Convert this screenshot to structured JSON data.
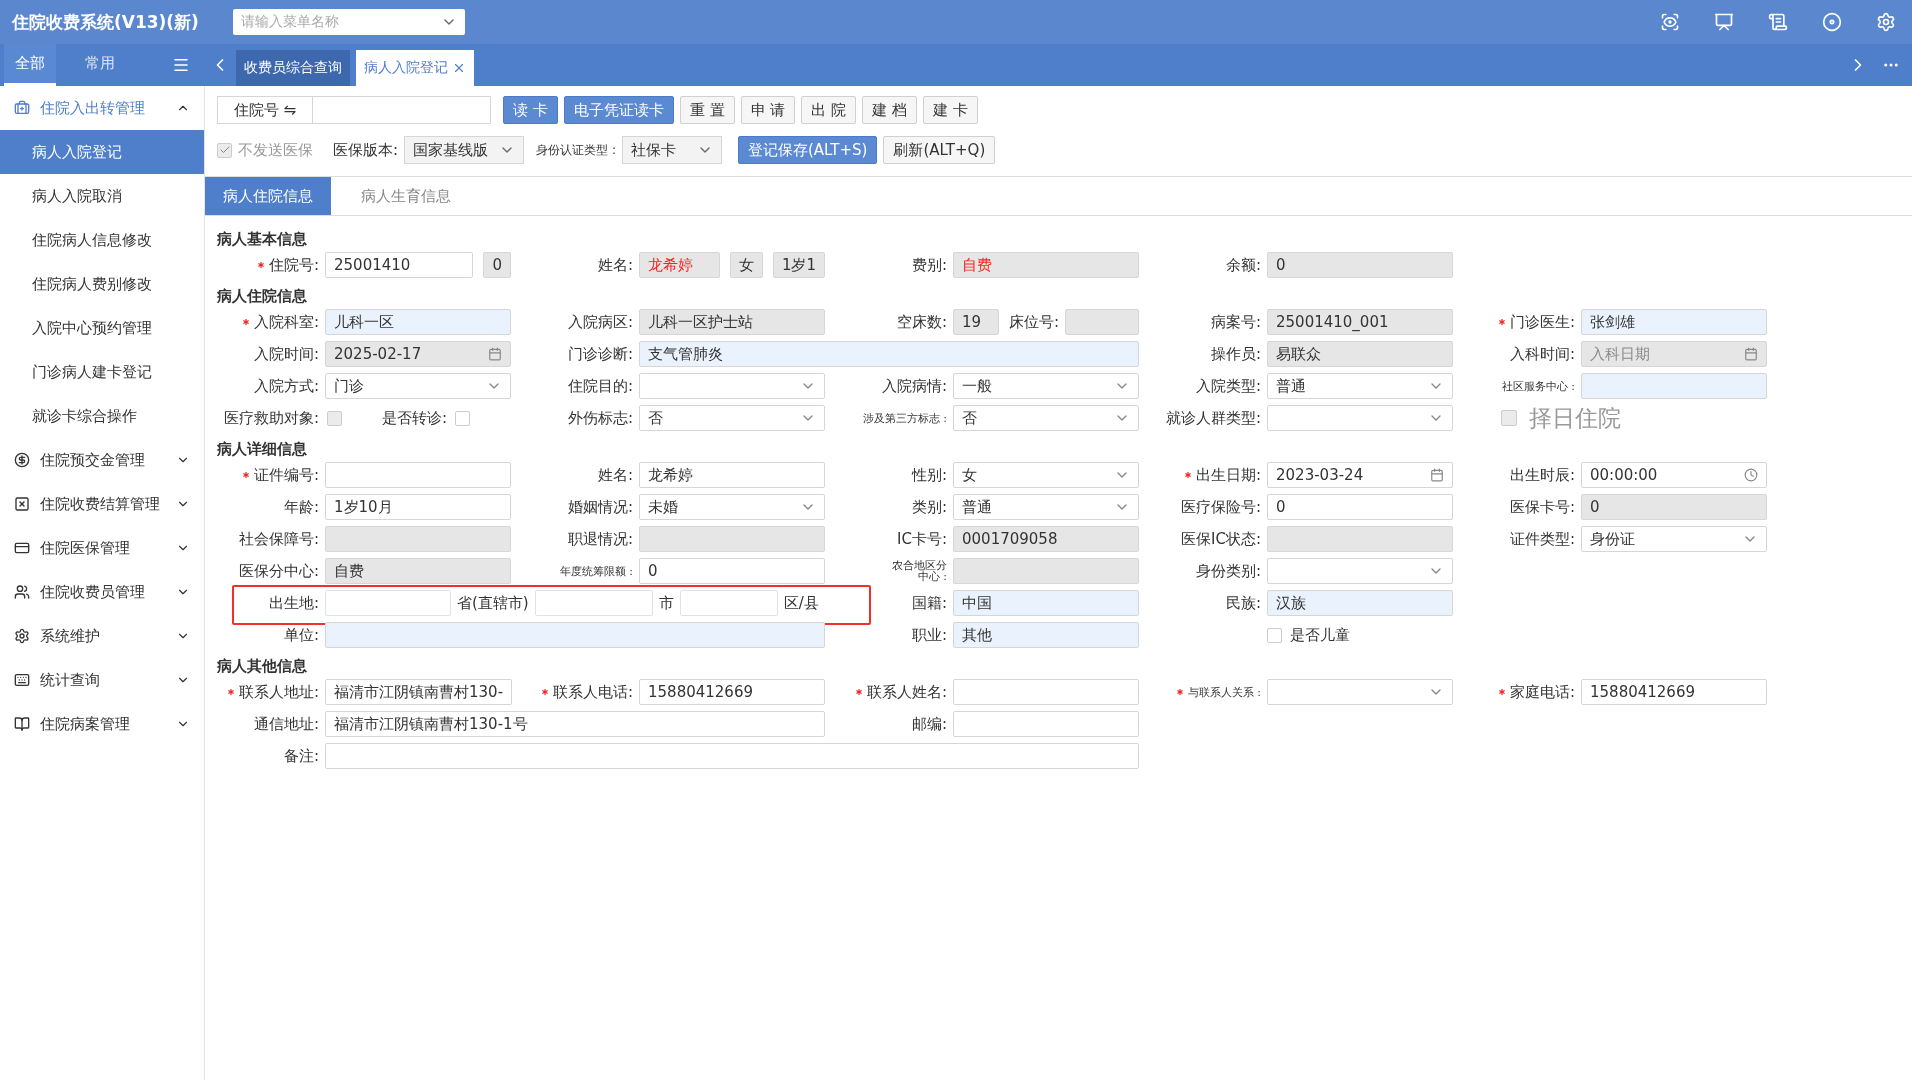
{
  "app_title": "住院收费系统(V13)(新)",
  "menu_search": {
    "placeholder": "请输入菜单名称"
  },
  "nav_tabs": [
    {
      "label": "全部",
      "selected": true
    },
    {
      "label": "常用",
      "selected": false
    }
  ],
  "page_tabs": [
    {
      "label": "收费员综合查询",
      "selected": false,
      "closable": false
    },
    {
      "label": "病人入院登记",
      "selected": true,
      "closable": true
    }
  ],
  "sidebar": [
    {
      "label": "住院入出转管理",
      "expanded": true,
      "children": [
        {
          "label": "病人入院登记",
          "selected": true
        },
        {
          "label": "病人入院取消",
          "selected": false
        },
        {
          "label": "住院病人信息修改",
          "selected": false
        },
        {
          "label": "住院病人费别修改",
          "selected": false
        },
        {
          "label": "入院中心预约管理",
          "selected": false
        },
        {
          "label": "门诊病人建卡登记",
          "selected": false
        },
        {
          "label": "就诊卡综合操作",
          "selected": false
        }
      ]
    },
    {
      "label": "住院预交金管理",
      "expanded": false
    },
    {
      "label": "住院收费结算管理",
      "expanded": false
    },
    {
      "label": "住院医保管理",
      "expanded": false
    },
    {
      "label": "住院收费员管理",
      "expanded": false
    },
    {
      "label": "系统维护",
      "expanded": false
    },
    {
      "label": "统计查询",
      "expanded": false
    },
    {
      "label": "住院病案管理",
      "expanded": false
    }
  ],
  "toolbar": {
    "id_type": "住院号 ⇋",
    "buttons": [
      {
        "label": "读 卡",
        "primary": true
      },
      {
        "label": "电子凭证读卡",
        "primary": true
      },
      {
        "label": "重 置",
        "primary": false
      },
      {
        "label": "申 请",
        "primary": false
      },
      {
        "label": "出 院",
        "primary": false
      },
      {
        "label": "建 档",
        "primary": false
      },
      {
        "label": "建 卡",
        "primary": false
      }
    ],
    "no_send": {
      "label": "不发送医保",
      "checked": true
    },
    "insurance_version": {
      "label": "医保版本:",
      "value": "国家基线版"
    },
    "auth_type": {
      "label": "身份认证类型 :",
      "value": "社保卡"
    },
    "actions": [
      {
        "label": "登记保存(ALT+S)",
        "primary": true
      },
      {
        "label": "刷新(ALT+Q)",
        "primary": false
      }
    ]
  },
  "sub_tabs": [
    {
      "label": "病人住院信息",
      "selected": true
    },
    {
      "label": "病人生育信息",
      "selected": false
    }
  ],
  "sections": [
    {
      "title": "病人基本信息",
      "rows": [
        [
          {
            "kind": "input",
            "label": "住院号:",
            "required": true,
            "value": "25001410",
            "readonly": false,
            "highlighted": false,
            "addons": [
              "0"
            ]
          },
          {
            "kind": "input",
            "label": "姓名:",
            "required": false,
            "value": "龙希婷",
            "readonly": true,
            "highlighted": false,
            "color": "#ff2020",
            "addons": [
              "女",
              "1岁1"
            ]
          },
          {
            "kind": "input",
            "label": "费别:",
            "required": false,
            "value": "自费",
            "readonly": true,
            "highlighted": false,
            "color": "#ff2020"
          },
          {
            "kind": "input",
            "label": "余额:",
            "required": false,
            "value": "0",
            "readonly": true,
            "highlighted": false
          }
        ]
      ]
    },
    {
      "title": "病人住院信息",
      "rows": [
        [
          {
            "kind": "input",
            "label": "入院科室:",
            "required": true,
            "value": "儿科一区",
            "readonly": false,
            "highlighted": true
          },
          {
            "kind": "input",
            "label": "入院病区:",
            "required": false,
            "value": "儿科一区护士站",
            "readonly": true,
            "highlighted": false
          },
          {
            "kind": "pair",
            "label": "空床数:",
            "required": false,
            "value": "19",
            "readonly": true,
            "highlighted": false,
            "sub_label": "床位号:",
            "sub_readonly": true
          },
          {
            "kind": "input",
            "label": "病案号:",
            "required": false,
            "value": "25001410_001",
            "readonly": true,
            "highlighted": false
          },
          {
            "kind": "input",
            "label": "门诊医生:",
            "required": true,
            "value": "张剑雄",
            "readonly": false,
            "highlighted": true
          }
        ],
        [
          {
            "kind": "date",
            "label": "入院时间:",
            "required": false,
            "value": "2025-02-17",
            "readonly": true,
            "highlighted": false
          },
          {
            "kind": "input",
            "label": "门诊诊断:",
            "required": false,
            "value": "支气管肺炎",
            "readonly": false,
            "highlighted": true
          },
          "",
          {
            "kind": "input",
            "label": "操作员:",
            "required": false,
            "value": "易联众",
            "readonly": true,
            "highlighted": false
          },
          {
            "kind": "date",
            "label": "入科时间:",
            "required": false,
            "placeholder": "入科日期",
            "readonly": true,
            "highlighted": false
          }
        ],
        [
          {
            "kind": "select",
            "label": "入院方式:",
            "required": false,
            "value": "门诊",
            "readonly": false,
            "highlighted": false
          },
          {
            "kind": "select",
            "label": "住院目的:",
            "required": false,
            "readonly": false,
            "highlighted": false
          },
          {
            "kind": "select",
            "label": "入院病情:",
            "required": false,
            "value": "一般",
            "readonly": false,
            "highlighted": false
          },
          {
            "kind": "select",
            "label": "入院类型:",
            "required": false,
            "value": "普通",
            "readonly": false,
            "highlighted": false
          },
          {
            "kind": "input",
            "label": "社区服务中心 :",
            "required": false,
            "small": true,
            "readonly": false,
            "highlighted": true
          }
        ],
        [
          {
            "kind": "checks",
            "items": [
              {
                "label": "医疗救助对象:",
                "checked": false,
                "disabled": true
              },
              {
                "label": "是否转诊:",
                "checked": false,
                "disabled": false
              }
            ]
          },
          {
            "kind": "select",
            "label": "外伤标志:",
            "required": false,
            "value": "否",
            "readonly": false,
            "highlighted": false
          },
          {
            "kind": "select",
            "label": "涉及第三方标志 :",
            "required": false,
            "small": true,
            "value": "否",
            "readonly": false,
            "highlighted": false
          },
          {
            "kind": "select",
            "label": "就诊人群类型:",
            "required": false,
            "readonly": false,
            "highlighted": false
          },
          {
            "kind": "bigcheck",
            "label": "择日住院",
            "checked": false,
            "disabled": true
          }
        ]
      ]
    },
    {
      "title": "病人详细信息",
      "rows": [
        [
          {
            "kind": "input",
            "label": "证件编号:",
            "required": true,
            "readonly": false,
            "highlighted": false
          },
          {
            "kind": "input",
            "label": "姓名:",
            "required": false,
            "value": "龙希婷",
            "readonly": false,
            "highlighted": false
          },
          {
            "kind": "select",
            "label": "性别:",
            "required": false,
            "value": "女",
            "readonly": false,
            "highlighted": false
          },
          {
            "kind": "date",
            "label": "出生日期:",
            "required": true,
            "value": "2023-03-24",
            "readonly": false,
            "highlighted": false
          },
          {
            "kind": "time",
            "label": "出生时辰:",
            "required": false,
            "value": "00:00:00",
            "readonly": false,
            "highlighted": false
          }
        ],
        [
          {
            "kind": "input",
            "label": "年龄:",
            "required": false,
            "value": "1岁10月",
            "readonly": false,
            "highlighted": false
          },
          {
            "kind": "select",
            "label": "婚姻情况:",
            "required": false,
            "value": "未婚",
            "readonly": false,
            "highlighted": false
          },
          {
            "kind": "select",
            "label": "类别:",
            "required": false,
            "value": "普通",
            "readonly": false,
            "highlighted": false
          },
          {
            "kind": "input",
            "label": "医疗保险号:",
            "required": false,
            "value": "0",
            "readonly": false,
            "highlighted": false
          },
          {
            "kind": "input",
            "label": "医保卡号:",
            "required": false,
            "value": "0",
            "readonly": true,
            "highlighted": false
          }
        ],
        [
          {
            "kind": "input",
            "label": "社会保障号:",
            "required": false,
            "readonly": true,
            "highlighted": false
          },
          {
            "kind": "input",
            "label": "职退情况:",
            "required": false,
            "readonly": true,
            "highlighted": false
          },
          {
            "kind": "input",
            "label": "IC卡号:",
            "required": false,
            "value": "0001709058",
            "readonly": true,
            "highlighted": false
          },
          {
            "kind": "input",
            "label": "医保IC状态:",
            "required": false,
            "readonly": true,
            "highlighted": false
          },
          {
            "kind": "select",
            "label": "证件类型:",
            "required": false,
            "value": "身份证",
            "readonly": false,
            "highlighted": false
          }
        ],
        [
          {
            "kind": "input",
            "label": "医保分中心:",
            "required": false,
            "value": "自费",
            "readonly": true,
            "highlighted": false
          },
          {
            "kind": "input",
            "label": "年度统筹限额 :",
            "required": false,
            "small": true,
            "value": "0",
            "readonly": false,
            "highlighted": false
          },
          {
            "kind": "input",
            "label": "农合地区分中心 :",
            "required": false,
            "small": true,
            "wrap": true,
            "readonly": true,
            "highlighted": false
          },
          {
            "kind": "select",
            "label": "身份类别:",
            "required": false,
            "readonly": false,
            "highlighted": false
          }
        ],
        [
          {
            "kind": "birthplace",
            "label": "出生地:",
            "highlighted": true,
            "parts": [
              {
                "unit": "省(直辖市)"
              },
              {
                "unit": "市"
              },
              {
                "unit": "区/县"
              }
            ]
          },
          "",
          {
            "kind": "input",
            "label": "国籍:",
            "required": false,
            "value": "中国",
            "readonly": false,
            "highlighted": true
          },
          {
            "kind": "input",
            "label": "民族:",
            "required": false,
            "value": "汉族",
            "readonly": false,
            "highlighted": true
          }
        ],
        [
          {
            "kind": "input",
            "label": "单位:",
            "required": false,
            "readonly": false,
            "highlighted": true
          },
          "",
          {
            "kind": "input",
            "label": "职业:",
            "required": false,
            "value": "其他",
            "readonly": false,
            "highlighted": true
          },
          {
            "kind": "checkbox",
            "label": "是否儿童",
            "checked": false
          }
        ]
      ]
    },
    {
      "title": "病人其他信息",
      "rows": [
        [
          {
            "kind": "input",
            "label": "联系人地址:",
            "required": true,
            "value": "福清市江阴镇南曹村130-",
            "readonly": false,
            "highlighted": false
          },
          {
            "kind": "input",
            "label": "联系人电话:",
            "required": true,
            "value": "15880412669",
            "readonly": false,
            "highlighted": false
          },
          {
            "kind": "input",
            "label": "联系人姓名:",
            "required": true,
            "readonly": false,
            "highlighted": false
          },
          {
            "kind": "select",
            "label": "与联系人关系 :",
            "required": true,
            "small": true,
            "readonly": false,
            "highlighted": false
          },
          {
            "kind": "input",
            "label": "家庭电话:",
            "required": true,
            "value": "15880412669",
            "readonly": false,
            "highlighted": false
          }
        ],
        [
          {
            "kind": "input",
            "label": "通信地址:",
            "required": false,
            "value": "福清市江阴镇南曹村130-1号",
            "readonly": false,
            "highlighted": false
          },
          "",
          {
            "kind": "input",
            "label": "邮编:",
            "required": false,
            "readonly": false,
            "highlighted": false
          }
        ],
        [
          {
            "kind": "input",
            "label": "备注:",
            "required": false,
            "readonly": false,
            "highlighted": false
          },
          "",
          ""
        ]
      ]
    }
  ]
}
